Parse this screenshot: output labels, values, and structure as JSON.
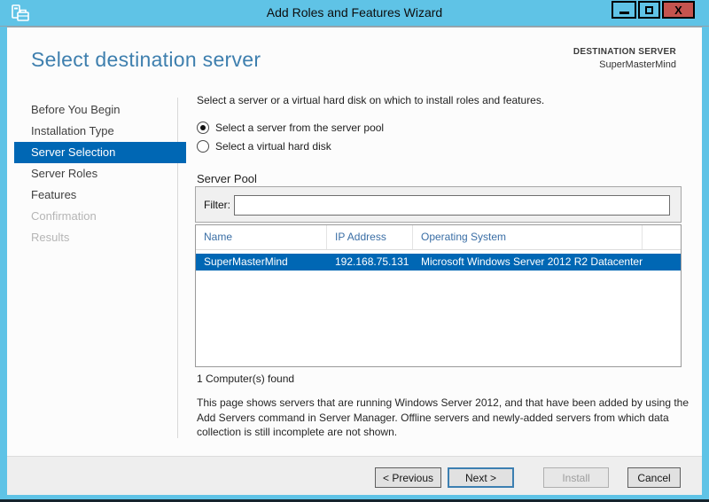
{
  "window": {
    "title": "Add Roles and Features Wizard",
    "controls": {
      "close_glyph": "X"
    }
  },
  "header": {
    "title": "Select destination server",
    "destination_label": "DESTINATION SERVER",
    "destination_value": "SuperMasterMind"
  },
  "sidebar": {
    "items": [
      {
        "label": "Before You Begin",
        "state": "normal"
      },
      {
        "label": "Installation Type",
        "state": "normal"
      },
      {
        "label": "Server Selection",
        "state": "selected"
      },
      {
        "label": "Server Roles",
        "state": "normal"
      },
      {
        "label": "Features",
        "state": "normal"
      },
      {
        "label": "Confirmation",
        "state": "disabled"
      },
      {
        "label": "Results",
        "state": "disabled"
      }
    ]
  },
  "main": {
    "intro": "Select a server or a virtual hard disk on which to install roles and features.",
    "radio_options": [
      {
        "label": "Select a server from the server pool",
        "selected": true
      },
      {
        "label": "Select a virtual hard disk",
        "selected": false
      }
    ],
    "server_pool": {
      "title": "Server Pool",
      "filter_label": "Filter:",
      "filter_value": "",
      "columns": [
        "Name",
        "IP Address",
        "Operating System"
      ],
      "rows": [
        {
          "name": "SuperMasterMind",
          "ip_address": "192.168.75.131",
          "operating_system": "Microsoft Windows Server 2012 R2 Datacenter",
          "selected": true
        }
      ],
      "result_count_text": "1 Computer(s) found"
    },
    "description": "This page shows servers that are running Windows Server 2012, and that have been added by using the Add Servers command in Server Manager. Offline servers and newly-added servers from which data collection is still incomplete are not shown."
  },
  "footer": {
    "buttons": [
      {
        "label": "< Previous",
        "state": "enabled"
      },
      {
        "label": "Next >",
        "state": "default-focused"
      },
      {
        "label": "Install",
        "state": "disabled"
      },
      {
        "label": "Cancel",
        "state": "enabled"
      }
    ]
  },
  "colors": {
    "frame_blue": "#5fc3e6",
    "accent_blue": "#0067b4",
    "heading_blue": "#3e7fae",
    "table_header_blue": "#3a6ea5",
    "close_red": "#c4544e"
  }
}
